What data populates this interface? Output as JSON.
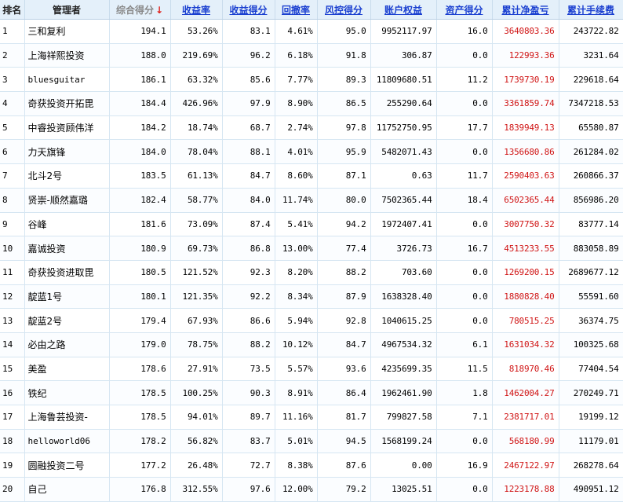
{
  "columns": [
    {
      "key": "rank",
      "label": "排名",
      "style": "plain"
    },
    {
      "key": "manager",
      "label": "管理者",
      "style": "plain"
    },
    {
      "key": "composite",
      "label": "综合得分",
      "style": "sorted",
      "sort_arrow": "↓"
    },
    {
      "key": "return_rate",
      "label": "收益率",
      "style": "link"
    },
    {
      "key": "return_score",
      "label": "收益得分",
      "style": "link"
    },
    {
      "key": "drawdown",
      "label": "回撤率",
      "style": "link"
    },
    {
      "key": "risk_score",
      "label": "风控得分",
      "style": "link"
    },
    {
      "key": "equity",
      "label": "账户权益",
      "style": "link"
    },
    {
      "key": "asset_score",
      "label": "资产得分",
      "style": "link"
    },
    {
      "key": "cum_pnl",
      "label": "累计净盈亏",
      "style": "link"
    },
    {
      "key": "cum_fee",
      "label": "累计手续费",
      "style": "link"
    }
  ],
  "colors": {
    "header_bg": "#e4f0fa",
    "link": "#1a3fd0",
    "profit": "#d01515",
    "grid": "#d6e6f2"
  },
  "rows": [
    {
      "rank": "1",
      "manager": "三和复利",
      "composite": "194.1",
      "return_rate": "53.26%",
      "return_score": "83.1",
      "drawdown": "4.61%",
      "risk_score": "95.0",
      "equity": "9952117.97",
      "asset_score": "16.0",
      "cum_pnl": "3640803.36",
      "cum_fee": "243722.82"
    },
    {
      "rank": "2",
      "manager": "上海祥熙投资",
      "composite": "188.0",
      "return_rate": "219.69%",
      "return_score": "96.2",
      "drawdown": "6.18%",
      "risk_score": "91.8",
      "equity": "306.87",
      "asset_score": "0.0",
      "cum_pnl": "122993.36",
      "cum_fee": "3231.64"
    },
    {
      "rank": "3",
      "manager": "bluesguitar",
      "composite": "186.1",
      "return_rate": "63.32%",
      "return_score": "85.6",
      "drawdown": "7.77%",
      "risk_score": "89.3",
      "equity": "11809680.51",
      "asset_score": "11.2",
      "cum_pnl": "1739730.19",
      "cum_fee": "229618.64"
    },
    {
      "rank": "4",
      "manager": "奇获投资开拓毘",
      "composite": "184.4",
      "return_rate": "426.96%",
      "return_score": "97.9",
      "drawdown": "8.90%",
      "risk_score": "86.5",
      "equity": "255290.64",
      "asset_score": "0.0",
      "cum_pnl": "3361859.74",
      "cum_fee": "7347218.53"
    },
    {
      "rank": "5",
      "manager": "中睿投资顾伟洋",
      "composite": "184.2",
      "return_rate": "18.74%",
      "return_score": "68.7",
      "drawdown": "2.74%",
      "risk_score": "97.8",
      "equity": "11752750.95",
      "asset_score": "17.7",
      "cum_pnl": "1839949.13",
      "cum_fee": "65580.87"
    },
    {
      "rank": "6",
      "manager": "力天旗锋",
      "composite": "184.0",
      "return_rate": "78.04%",
      "return_score": "88.1",
      "drawdown": "4.01%",
      "risk_score": "95.9",
      "equity": "5482071.43",
      "asset_score": "0.0",
      "cum_pnl": "1356680.86",
      "cum_fee": "261284.02"
    },
    {
      "rank": "7",
      "manager": "北斗2号",
      "composite": "183.5",
      "return_rate": "61.13%",
      "return_score": "84.7",
      "drawdown": "8.60%",
      "risk_score": "87.1",
      "equity": "0.63",
      "asset_score": "11.7",
      "cum_pnl": "2590403.63",
      "cum_fee": "260866.37"
    },
    {
      "rank": "8",
      "manager": "贤崇-顺然嘉璐",
      "composite": "182.4",
      "return_rate": "58.77%",
      "return_score": "84.0",
      "drawdown": "11.74%",
      "risk_score": "80.0",
      "equity": "7502365.44",
      "asset_score": "18.4",
      "cum_pnl": "6502365.44",
      "cum_fee": "856986.20"
    },
    {
      "rank": "9",
      "manager": "谷峰",
      "composite": "181.6",
      "return_rate": "73.09%",
      "return_score": "87.4",
      "drawdown": "5.41%",
      "risk_score": "94.2",
      "equity": "1972407.41",
      "asset_score": "0.0",
      "cum_pnl": "3007750.32",
      "cum_fee": "83777.14"
    },
    {
      "rank": "10",
      "manager": "嘉诚投资",
      "composite": "180.9",
      "return_rate": "69.73%",
      "return_score": "86.8",
      "drawdown": "13.00%",
      "risk_score": "77.4",
      "equity": "3726.73",
      "asset_score": "16.7",
      "cum_pnl": "4513233.55",
      "cum_fee": "883058.89"
    },
    {
      "rank": "11",
      "manager": "奇获投资进取毘",
      "composite": "180.5",
      "return_rate": "121.52%",
      "return_score": "92.3",
      "drawdown": "8.20%",
      "risk_score": "88.2",
      "equity": "703.60",
      "asset_score": "0.0",
      "cum_pnl": "1269200.15",
      "cum_fee": "2689677.12"
    },
    {
      "rank": "12",
      "manager": "靛蓝1号",
      "composite": "180.1",
      "return_rate": "121.35%",
      "return_score": "92.2",
      "drawdown": "8.34%",
      "risk_score": "87.9",
      "equity": "1638328.40",
      "asset_score": "0.0",
      "cum_pnl": "1880828.40",
      "cum_fee": "55591.60"
    },
    {
      "rank": "13",
      "manager": "靛蓝2号",
      "composite": "179.4",
      "return_rate": "67.93%",
      "return_score": "86.6",
      "drawdown": "5.94%",
      "risk_score": "92.8",
      "equity": "1040615.25",
      "asset_score": "0.0",
      "cum_pnl": "780515.25",
      "cum_fee": "36374.75"
    },
    {
      "rank": "14",
      "manager": "必由之路",
      "composite": "179.0",
      "return_rate": "78.75%",
      "return_score": "88.2",
      "drawdown": "10.12%",
      "risk_score": "84.7",
      "equity": "4967534.32",
      "asset_score": "6.1",
      "cum_pnl": "1631034.32",
      "cum_fee": "100325.68"
    },
    {
      "rank": "15",
      "manager": "美盈",
      "composite": "178.6",
      "return_rate": "27.91%",
      "return_score": "73.5",
      "drawdown": "5.57%",
      "risk_score": "93.6",
      "equity": "4235699.35",
      "asset_score": "11.5",
      "cum_pnl": "818970.46",
      "cum_fee": "77404.54"
    },
    {
      "rank": "16",
      "manager": "铁纪",
      "composite": "178.5",
      "return_rate": "100.25%",
      "return_score": "90.3",
      "drawdown": "8.91%",
      "risk_score": "86.4",
      "equity": "1962461.90",
      "asset_score": "1.8",
      "cum_pnl": "1462004.27",
      "cum_fee": "270249.71"
    },
    {
      "rank": "17",
      "manager": "上海鲁芸投资-",
      "composite": "178.5",
      "return_rate": "94.01%",
      "return_score": "89.7",
      "drawdown": "11.16%",
      "risk_score": "81.7",
      "equity": "799827.58",
      "asset_score": "7.1",
      "cum_pnl": "2381717.01",
      "cum_fee": "19199.12"
    },
    {
      "rank": "18",
      "manager": "helloworld06",
      "composite": "178.2",
      "return_rate": "56.82%",
      "return_score": "83.7",
      "drawdown": "5.01%",
      "risk_score": "94.5",
      "equity": "1568199.24",
      "asset_score": "0.0",
      "cum_pnl": "568180.99",
      "cum_fee": "11179.01"
    },
    {
      "rank": "19",
      "manager": "圆融投资二号",
      "composite": "177.2",
      "return_rate": "26.48%",
      "return_score": "72.7",
      "drawdown": "8.38%",
      "risk_score": "87.6",
      "equity": "0.00",
      "asset_score": "16.9",
      "cum_pnl": "2467122.97",
      "cum_fee": "268278.64"
    },
    {
      "rank": "20",
      "manager": "自己",
      "composite": "176.8",
      "return_rate": "312.55%",
      "return_score": "97.6",
      "drawdown": "12.00%",
      "risk_score": "79.2",
      "equity": "13025.51",
      "asset_score": "0.0",
      "cum_pnl": "1223178.88",
      "cum_fee": "490951.12"
    }
  ]
}
